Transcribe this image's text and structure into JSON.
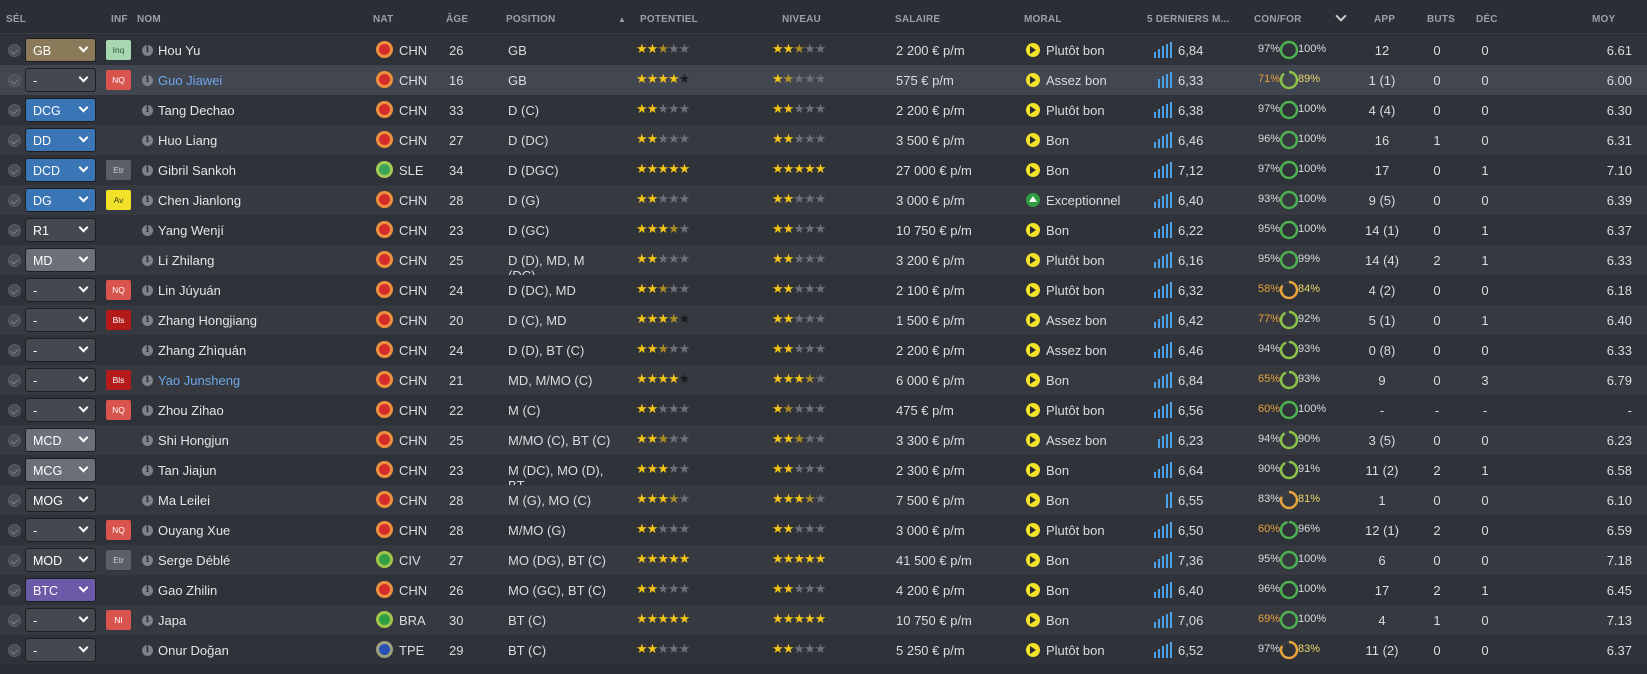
{
  "columns": {
    "sel": "SÉL",
    "inf": "INF",
    "nom": "NOM",
    "nat": "NAT",
    "age": "ÂGE",
    "position": "POSITION",
    "potentiel": "POTENTIEL",
    "niveau": "NIVEAU",
    "salaire": "SALAIRE",
    "moral": "MORAL",
    "derniers": "5 DERNIERS M...",
    "confor": "CON/FOR",
    "app": "APP",
    "buts": "BUTS",
    "dec": "DÉC",
    "moy": "MOY"
  },
  "colors": {
    "role_gk": "#8a7a5a",
    "role_def": "#3a76b5",
    "role_mid": "#6b7078",
    "role_att": "#6b5aa8",
    "role_none": "#44484f",
    "cond_good": "#d9dce0",
    "cond_low": "#e8a33a",
    "star_on": "#f5c518",
    "moral_yellow": "#f2e22a",
    "moral_green": "#2f9e44"
  },
  "players": [
    {
      "role": "GB",
      "role_color": "#8a7a5a",
      "info": "Inq",
      "info_bg": "#a7d7b0",
      "info_fg": "#2f5a36",
      "name": "Hou Yu",
      "blue": false,
      "flag": "#d62b2b",
      "nat": "CHN",
      "age": "26",
      "position": "GB",
      "pot": 2.5,
      "pot_dark": 0,
      "niv": 2.5,
      "salary": "2 200 € p/m",
      "moral": "Plutôt bon",
      "moral_type": "play",
      "bars": 5,
      "avg5": "6,84",
      "cond": "97%",
      "cond_low": false,
      "fit": "100%",
      "fitness": 1.0,
      "app": "12",
      "goals": "0",
      "dec": "0",
      "avg": "6.61"
    },
    {
      "role": "-",
      "role_color": "#44484f",
      "info": "NQ",
      "info_bg": "#d9534f",
      "info_fg": "#fff",
      "name": "Guo Jiawei",
      "blue": true,
      "flag": "#d62b2b",
      "nat": "CHN",
      "age": "16",
      "position": "GB",
      "pot": 4,
      "pot_dark": 1,
      "niv": 1.5,
      "salary": "575 € p/m",
      "moral": "Assez bon",
      "moral_type": "play",
      "bars": 4,
      "avg5": "6,33",
      "cond": "71%",
      "cond_low": true,
      "fit": "89%",
      "fitness": 0.89,
      "app": "1 (1)",
      "goals": "0",
      "dec": "0",
      "avg": "6.00",
      "sel": true
    },
    {
      "role": "DCG",
      "role_color": "#3a76b5",
      "info": "",
      "name": "Tang Dechao",
      "blue": false,
      "flag": "#d62b2b",
      "nat": "CHN",
      "age": "33",
      "position": "D (C)",
      "pot": 2,
      "pot_dark": 0,
      "niv": 2,
      "salary": "2 200 € p/m",
      "moral": "Plutôt bon",
      "moral_type": "play",
      "bars": 5,
      "avg5": "6,38",
      "cond": "97%",
      "cond_low": false,
      "fit": "100%",
      "fitness": 1.0,
      "app": "4 (4)",
      "goals": "0",
      "dec": "0",
      "avg": "6.30"
    },
    {
      "role": "DD",
      "role_color": "#3a76b5",
      "info": "",
      "name": "Huo Liang",
      "blue": false,
      "flag": "#d62b2b",
      "nat": "CHN",
      "age": "27",
      "position": "D (DC)",
      "pot": 2,
      "pot_dark": 0,
      "niv": 2,
      "salary": "3 500 € p/m",
      "moral": "Bon",
      "moral_type": "play",
      "bars": 5,
      "avg5": "6,46",
      "cond": "96%",
      "cond_low": false,
      "fit": "100%",
      "fitness": 1.0,
      "app": "16",
      "goals": "1",
      "dec": "0",
      "avg": "6.31"
    },
    {
      "role": "DCD",
      "role_color": "#3a76b5",
      "info": "Etr",
      "info_bg": "#5a5e66",
      "info_fg": "#c9ccd1",
      "name": "Gibril Sankoh",
      "blue": false,
      "flag": "#3aa55a",
      "nat": "SLE",
      "age": "34",
      "position": "D (DGC)",
      "pot": 5,
      "pot_dark": 0,
      "niv": 5,
      "salary": "27 000 € p/m",
      "moral": "Bon",
      "moral_type": "play",
      "bars": 5,
      "avg5": "7,12",
      "cond": "97%",
      "cond_low": false,
      "fit": "100%",
      "fitness": 1.0,
      "app": "17",
      "goals": "0",
      "dec": "1",
      "avg": "7.10"
    },
    {
      "role": "DG",
      "role_color": "#3a76b5",
      "info": "Av",
      "info_bg": "#f2e22a",
      "info_fg": "#3a3a1a",
      "name": "Chen Jianlong",
      "blue": false,
      "flag": "#d62b2b",
      "nat": "CHN",
      "age": "28",
      "position": "D (G)",
      "pot": 2,
      "pot_dark": 0,
      "niv": 2,
      "salary": "3 000 € p/m",
      "moral": "Exceptionnel",
      "moral_type": "exc",
      "bars": 5,
      "avg5": "6,40",
      "cond": "93%",
      "cond_low": false,
      "fit": "100%",
      "fitness": 1.0,
      "app": "9 (5)",
      "goals": "0",
      "dec": "0",
      "avg": "6.39"
    },
    {
      "role": "R1",
      "role_color": "#44484f",
      "info": "",
      "name": "Yang Wenjí",
      "blue": false,
      "flag": "#d62b2b",
      "nat": "CHN",
      "age": "23",
      "position": "D (GC)",
      "pot": 3.5,
      "pot_dark": 0,
      "niv": 2,
      "salary": "10 750 € p/m",
      "moral": "Bon",
      "moral_type": "play",
      "bars": 5,
      "avg5": "6,22",
      "cond": "95%",
      "cond_low": false,
      "fit": "100%",
      "fitness": 1.0,
      "app": "14 (1)",
      "goals": "0",
      "dec": "1",
      "avg": "6.37"
    },
    {
      "role": "MD",
      "role_color": "#6b7078",
      "info": "",
      "name": "Li Zhilang",
      "blue": false,
      "flag": "#d62b2b",
      "nat": "CHN",
      "age": "25",
      "position": "D (D), MD, M (DC),...",
      "pot": 2,
      "pot_dark": 0,
      "niv": 2,
      "salary": "3 200 € p/m",
      "moral": "Plutôt bon",
      "moral_type": "play",
      "bars": 5,
      "avg5": "6,16",
      "cond": "95%",
      "cond_low": false,
      "fit": "99%",
      "fitness": 0.99,
      "app": "14 (4)",
      "goals": "2",
      "dec": "1",
      "avg": "6.33"
    },
    {
      "role": "-",
      "role_color": "#44484f",
      "info": "NQ",
      "info_bg": "#d9534f",
      "info_fg": "#fff",
      "name": "Lin Júyuán",
      "blue": false,
      "flag": "#d62b2b",
      "nat": "CHN",
      "age": "24",
      "position": "D (DC), MD",
      "pot": 2.5,
      "pot_dark": 0,
      "niv": 2,
      "salary": "2 100 € p/m",
      "moral": "Plutôt bon",
      "moral_type": "play",
      "bars": 5,
      "avg5": "6,32",
      "cond": "58%",
      "cond_low": true,
      "fit": "84%",
      "fitness": 0.84,
      "app": "4 (2)",
      "goals": "0",
      "dec": "0",
      "avg": "6.18"
    },
    {
      "role": "-",
      "role_color": "#44484f",
      "info": "Bls",
      "info_bg": "#b31b1b",
      "info_fg": "#fff",
      "name": "Zhang Hongjiang",
      "blue": false,
      "flag": "#d62b2b",
      "nat": "CHN",
      "age": "20",
      "position": "D (C), MD",
      "pot": 3.5,
      "pot_dark": 1,
      "niv": 2,
      "salary": "1 500 € p/m",
      "moral": "Assez bon",
      "moral_type": "play",
      "bars": 5,
      "avg5": "6,42",
      "cond": "77%",
      "cond_low": true,
      "fit": "92%",
      "fitness": 0.92,
      "app": "5 (1)",
      "goals": "0",
      "dec": "1",
      "avg": "6.40"
    },
    {
      "role": "-",
      "role_color": "#44484f",
      "info": "",
      "name": "Zhang Zhìquán",
      "blue": false,
      "flag": "#d62b2b",
      "nat": "CHN",
      "age": "24",
      "position": "D (D), BT (C)",
      "pot": 2.5,
      "pot_dark": 0,
      "niv": 2,
      "salary": "2 200 € p/m",
      "moral": "Assez bon",
      "moral_type": "play",
      "bars": 5,
      "avg5": "6,46",
      "cond": "94%",
      "cond_low": false,
      "fit": "93%",
      "fitness": 0.93,
      "app": "0 (8)",
      "goals": "0",
      "dec": "0",
      "avg": "6.33"
    },
    {
      "role": "-",
      "role_color": "#44484f",
      "info": "Bls",
      "info_bg": "#b31b1b",
      "info_fg": "#fff",
      "name": "Yao Junsheng",
      "blue": true,
      "flag": "#d62b2b",
      "nat": "CHN",
      "age": "21",
      "position": "MD, M/MO (C)",
      "pot": 4,
      "pot_dark": 1,
      "niv": 3.5,
      "salary": "6 000 € p/m",
      "moral": "Bon",
      "moral_type": "play",
      "bars": 5,
      "avg5": "6,84",
      "cond": "65%",
      "cond_low": true,
      "fit": "93%",
      "fitness": 0.93,
      "app": "9",
      "goals": "0",
      "dec": "3",
      "avg": "6.79"
    },
    {
      "role": "-",
      "role_color": "#44484f",
      "info": "NQ",
      "info_bg": "#d9534f",
      "info_fg": "#fff",
      "name": "Zhou Zihao",
      "blue": false,
      "flag": "#d62b2b",
      "nat": "CHN",
      "age": "22",
      "position": "M (C)",
      "pot": 2,
      "pot_dark": 0,
      "niv": 1.5,
      "salary": "475 € p/m",
      "moral": "Plutôt bon",
      "moral_type": "play",
      "bars": 5,
      "avg5": "6,56",
      "cond": "60%",
      "cond_low": true,
      "fit": "100%",
      "fitness": 1.0,
      "app": "-",
      "goals": "-",
      "dec": "-",
      "avg": "-"
    },
    {
      "role": "MCD",
      "role_color": "#6b7078",
      "info": "",
      "name": "Shi Hongjun",
      "blue": false,
      "flag": "#d62b2b",
      "nat": "CHN",
      "age": "25",
      "position": "M/MO (C), BT (C)",
      "pot": 2.5,
      "pot_dark": 0,
      "niv": 2.5,
      "salary": "3 300 € p/m",
      "moral": "Assez bon",
      "moral_type": "play",
      "bars": 4,
      "avg5": "6,23",
      "cond": "94%",
      "cond_low": false,
      "fit": "90%",
      "fitness": 0.9,
      "app": "3 (5)",
      "goals": "0",
      "dec": "0",
      "avg": "6.23"
    },
    {
      "role": "MCG",
      "role_color": "#6b7078",
      "info": "",
      "name": "Tan Jiajun",
      "blue": false,
      "flag": "#d62b2b",
      "nat": "CHN",
      "age": "23",
      "position": "M (DC), MO (D), BT...",
      "pot": 3,
      "pot_dark": 0,
      "niv": 2,
      "salary": "2 300 € p/m",
      "moral": "Bon",
      "moral_type": "play",
      "bars": 5,
      "avg5": "6,64",
      "cond": "90%",
      "cond_low": false,
      "fit": "91%",
      "fitness": 0.91,
      "app": "11 (2)",
      "goals": "2",
      "dec": "1",
      "avg": "6.58"
    },
    {
      "role": "MOG",
      "role_color": "#44484f",
      "info": "",
      "name": "Ma Leilei",
      "blue": false,
      "flag": "#d62b2b",
      "nat": "CHN",
      "age": "28",
      "position": "M (G), MO (C)",
      "pot": 3.5,
      "pot_dark": 0,
      "niv": 3.5,
      "salary": "7 500 € p/m",
      "moral": "Bon",
      "moral_type": "play",
      "bars": 2,
      "avg5": "6,55",
      "cond": "83%",
      "cond_low": false,
      "fit": "81%",
      "fitness": 0.81,
      "app": "1",
      "goals": "0",
      "dec": "0",
      "avg": "6.10"
    },
    {
      "role": "-",
      "role_color": "#44484f",
      "info": "NQ",
      "info_bg": "#d9534f",
      "info_fg": "#fff",
      "name": "Ouyang Xue",
      "blue": false,
      "flag": "#d62b2b",
      "nat": "CHN",
      "age": "28",
      "position": "M/MO (G)",
      "pot": 2,
      "pot_dark": 0,
      "niv": 2,
      "salary": "3 000 € p/m",
      "moral": "Plutôt bon",
      "moral_type": "play",
      "bars": 5,
      "avg5": "6,50",
      "cond": "60%",
      "cond_low": true,
      "fit": "96%",
      "fitness": 0.96,
      "app": "12 (1)",
      "goals": "2",
      "dec": "0",
      "avg": "6.59"
    },
    {
      "role": "MOD",
      "role_color": "#44484f",
      "info": "Etr",
      "info_bg": "#5a5e66",
      "info_fg": "#c9ccd1",
      "name": "Serge Déblé",
      "blue": false,
      "flag": "#2f9e44",
      "nat": "CIV",
      "age": "27",
      "position": "MO (DG), BT (C)",
      "pot": 5,
      "pot_dark": 0,
      "niv": 5,
      "salary": "41 500 € p/m",
      "moral": "Bon",
      "moral_type": "play",
      "bars": 5,
      "avg5": "7,36",
      "cond": "95%",
      "cond_low": false,
      "fit": "100%",
      "fitness": 1.0,
      "app": "6",
      "goals": "0",
      "dec": "0",
      "avg": "7.18"
    },
    {
      "role": "BTC",
      "role_color": "#6b5aa8",
      "info": "",
      "name": "Gao Zhilin",
      "blue": false,
      "flag": "#d62b2b",
      "nat": "CHN",
      "age": "26",
      "position": "MO (GC), BT (C)",
      "pot": 2,
      "pot_dark": 0,
      "niv": 2,
      "salary": "4 200 € p/m",
      "moral": "Bon",
      "moral_type": "play",
      "bars": 5,
      "avg5": "6,40",
      "cond": "96%",
      "cond_low": false,
      "fit": "100%",
      "fitness": 1.0,
      "app": "17",
      "goals": "2",
      "dec": "1",
      "avg": "6.45"
    },
    {
      "role": "-",
      "role_color": "#44484f",
      "info": "NI",
      "info_bg": "#d9534f",
      "info_fg": "#fff",
      "name": "Japa",
      "blue": false,
      "flag": "#2f9e44",
      "nat": "BRA",
      "age": "30",
      "position": "BT (C)",
      "pot": 5,
      "pot_dark": 0,
      "niv": 5,
      "salary": "10 750 € p/m",
      "moral": "Bon",
      "moral_type": "play",
      "bars": 5,
      "avg5": "7,06",
      "cond": "69%",
      "cond_low": true,
      "fit": "100%",
      "fitness": 1.0,
      "app": "4",
      "goals": "1",
      "dec": "0",
      "avg": "7.13"
    },
    {
      "role": "-",
      "role_color": "#44484f",
      "info": "",
      "name": "Onur Doğan",
      "blue": false,
      "flag": "#2a4fb5",
      "nat": "TPE",
      "age": "29",
      "position": "BT (C)",
      "pot": 2,
      "pot_dark": 0,
      "niv": 2,
      "salary": "5 250 € p/m",
      "moral": "Plutôt bon",
      "moral_type": "play",
      "bars": 5,
      "avg5": "6,52",
      "cond": "97%",
      "cond_low": false,
      "fit": "83%",
      "fitness": 0.83,
      "app": "11 (2)",
      "goals": "0",
      "dec": "0",
      "avg": "6.37"
    }
  ]
}
